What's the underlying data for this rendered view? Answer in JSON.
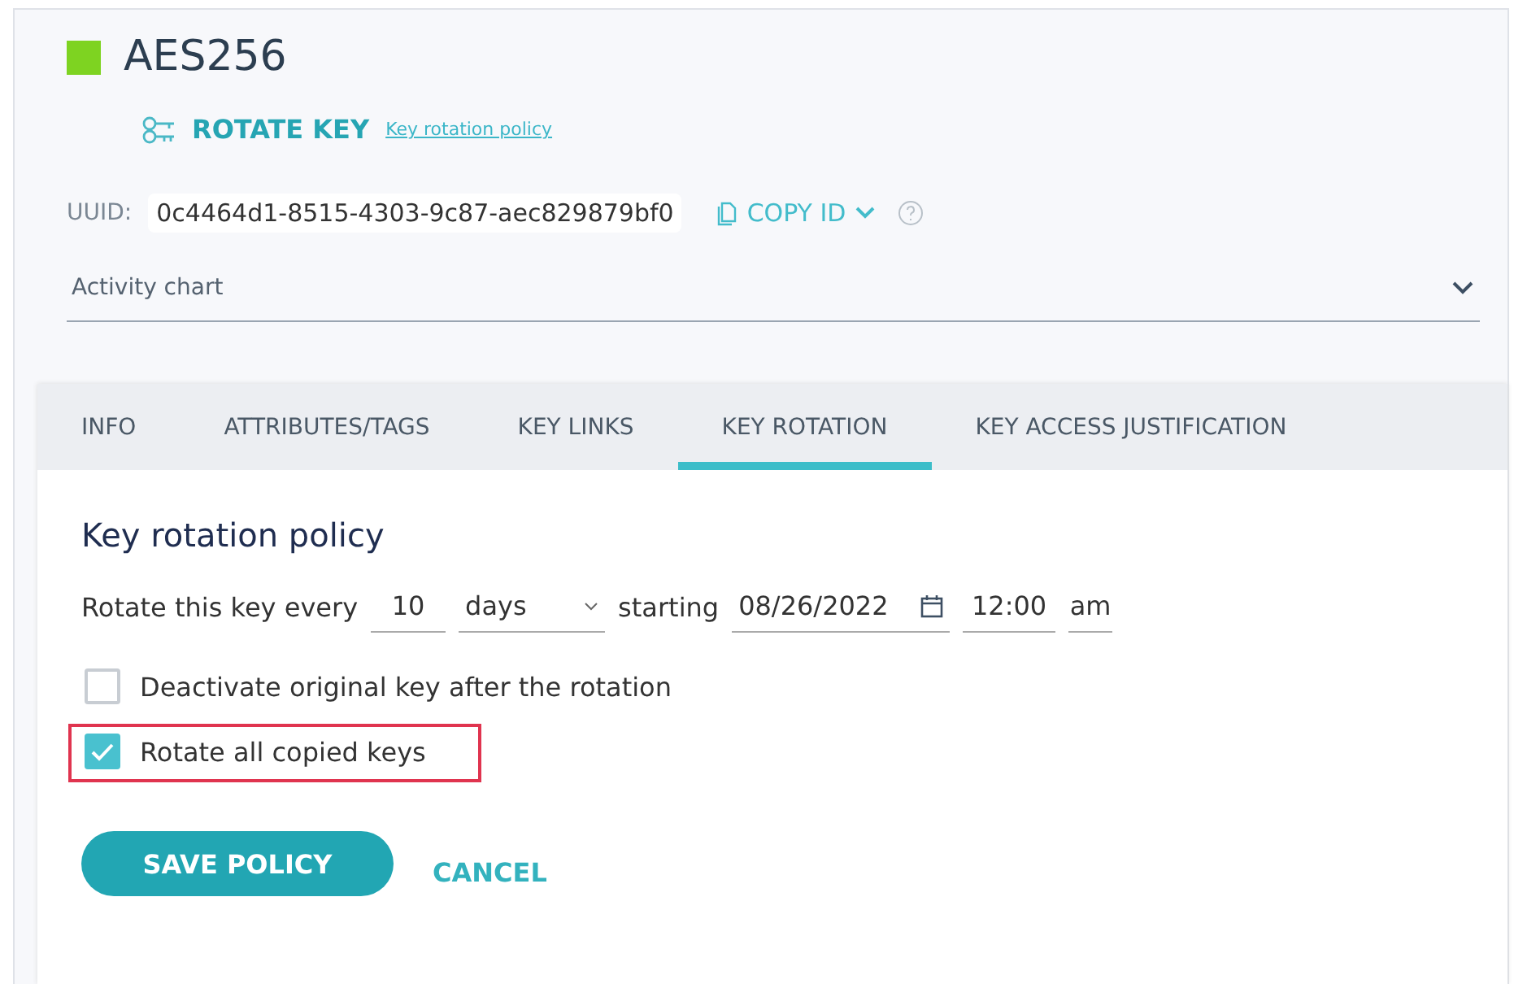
{
  "key": {
    "name": "AES256",
    "color": "#7ed321"
  },
  "rotate": {
    "label": "ROTATE KEY",
    "link": "Key rotation policy"
  },
  "uuid": {
    "label": "UUID:",
    "value": "0c4464d1-8515-4303-9c87-aec829879bf0",
    "copy": "COPY ID"
  },
  "activity": {
    "label": "Activity chart",
    "expanded": false
  },
  "tabs": [
    {
      "label": "INFO",
      "selected": false
    },
    {
      "label": "ATTRIBUTES/TAGS",
      "selected": false
    },
    {
      "label": "KEY LINKS",
      "selected": false
    },
    {
      "label": "KEY ROTATION",
      "selected": true
    },
    {
      "label": "KEY ACCESS JUSTIFICATION",
      "selected": false
    }
  ],
  "policy": {
    "title": "Key rotation policy",
    "prefix": "Rotate this key every",
    "interval": "10",
    "unit": "days",
    "starting": "starting",
    "date": "08/26/2022",
    "time": "12:00",
    "ampm": "am",
    "options": [
      {
        "label": "Deactivate original key after the rotation",
        "checked": false,
        "highlighted": false
      },
      {
        "label": "Rotate all copied keys",
        "checked": true,
        "highlighted": true
      }
    ],
    "save": "SAVE POLICY",
    "cancel": "CANCEL"
  }
}
